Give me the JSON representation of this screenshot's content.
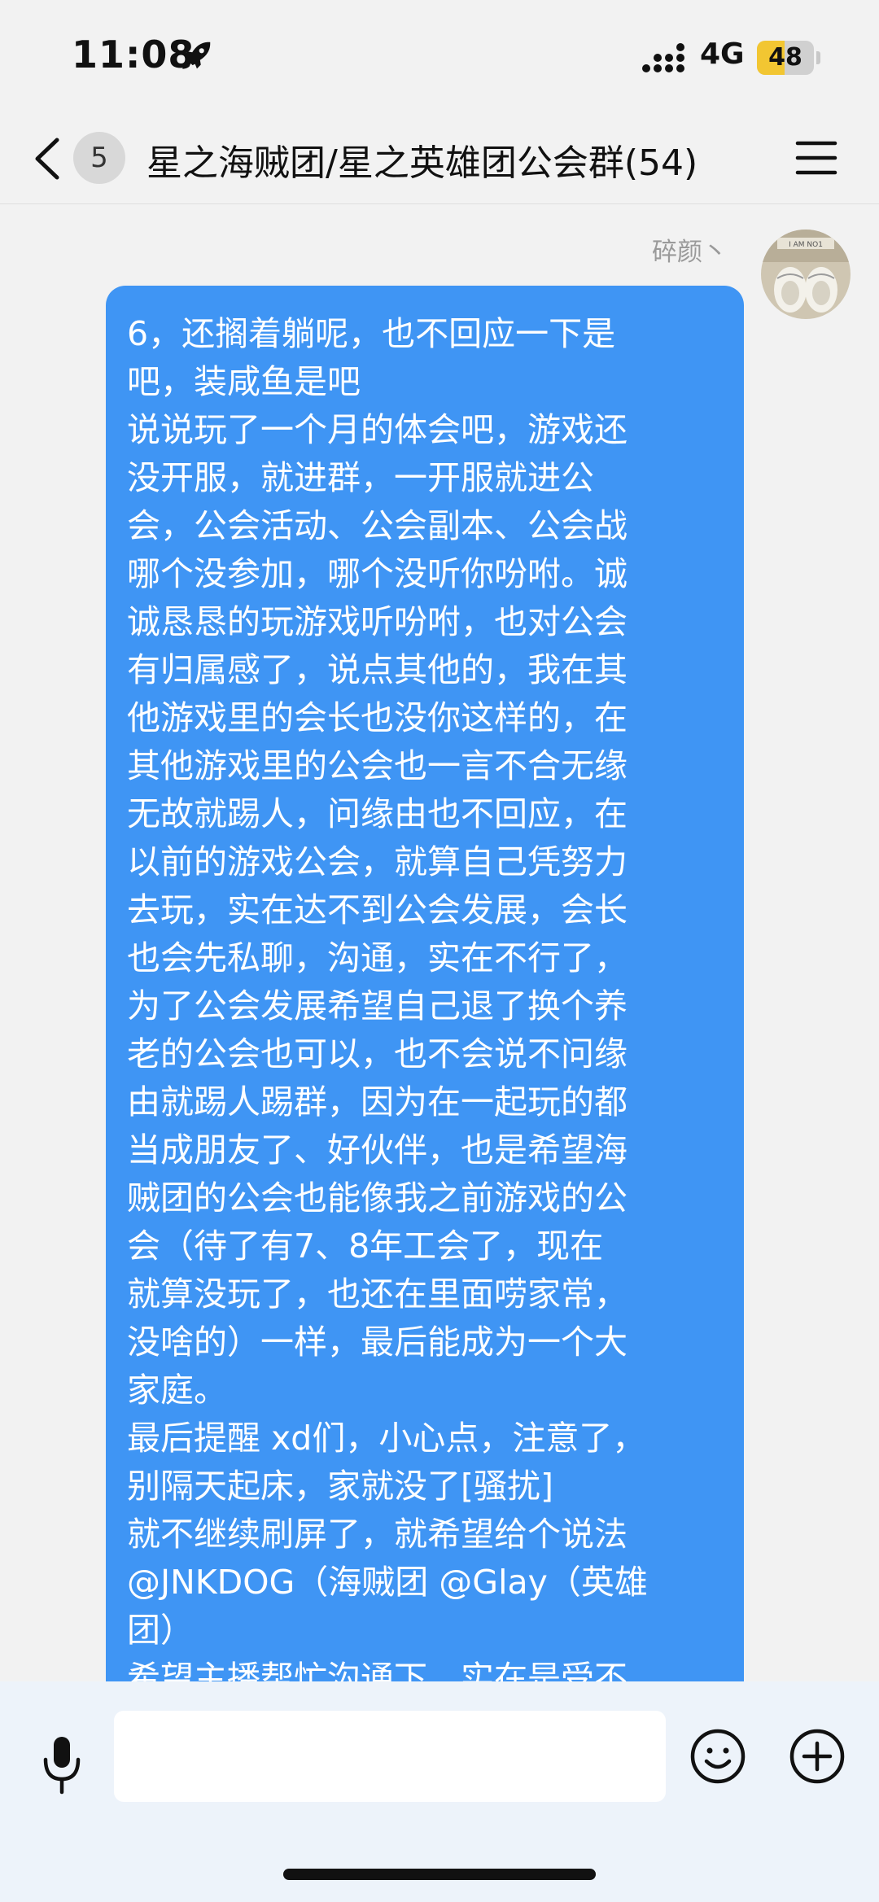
{
  "status_bar": {
    "time": "11:08",
    "network": "4G",
    "battery": "48",
    "battery_level": 0.48,
    "icons": [
      "rocket-icon",
      "signal-icon",
      "battery-icon"
    ]
  },
  "nav": {
    "back_icon": "chevron-left-icon",
    "unread_count": "5",
    "title": "星之海贼团/星之英雄团公会群(54)",
    "menu_icon": "hamburger-menu-icon"
  },
  "chat": {
    "messages": [
      {
        "sender": "碎颜丶",
        "avatar": "avatar-sneakers",
        "text": "6，还搁着躺呢，也不回应一下是\n吧，装咸鱼是吧\n说说玩了一个月的体会吧，游戏还\n没开服，就进群，一开服就进公\n会，公会活动、公会副本、公会战\n哪个没参加，哪个没听你吩咐。诚\n诚恳恳的玩游戏听吩咐，也对公会\n有归属感了，说点其他的，我在其\n他游戏里的会长也没你这样的，在\n其他游戏里的公会也一言不合无缘\n无故就踢人，问缘由也不回应，在\n以前的游戏公会，就算自己凭努力\n去玩，实在达不到公会发展，会长\n也会先私聊，沟通，实在不行了，\n为了公会发展希望自己退了换个养\n老的公会也可以，也不会说不问缘\n由就踢人踢群，因为在一起玩的都\n当成朋友了、好伙伴，也是希望海\n贼团的公会也能像我之前游戏的公\n会（待了有7、8年工会了，现在\n就算没玩了，也还在里面唠家常，\n没啥的）一样，最后能成为一个大\n家庭。\n最后提醒 xd们，小心点，注意了，\n别隔天起床，家就没了[骚扰]\n就不继续刷屏了，就希望给个说法\n@JNKDOG（海贼团 @Glay（英雄\n团）\n希望主播帮忙沟通下，实在是受不",
        "bubble_color": "#3f95f4"
      }
    ],
    "scroll_down_icon": "chevron-down-icon"
  },
  "input_bar": {
    "text_value": "",
    "placeholder": "",
    "icons": [
      "microphone-icon",
      "emoji-icon",
      "plus-circle-icon"
    ]
  }
}
